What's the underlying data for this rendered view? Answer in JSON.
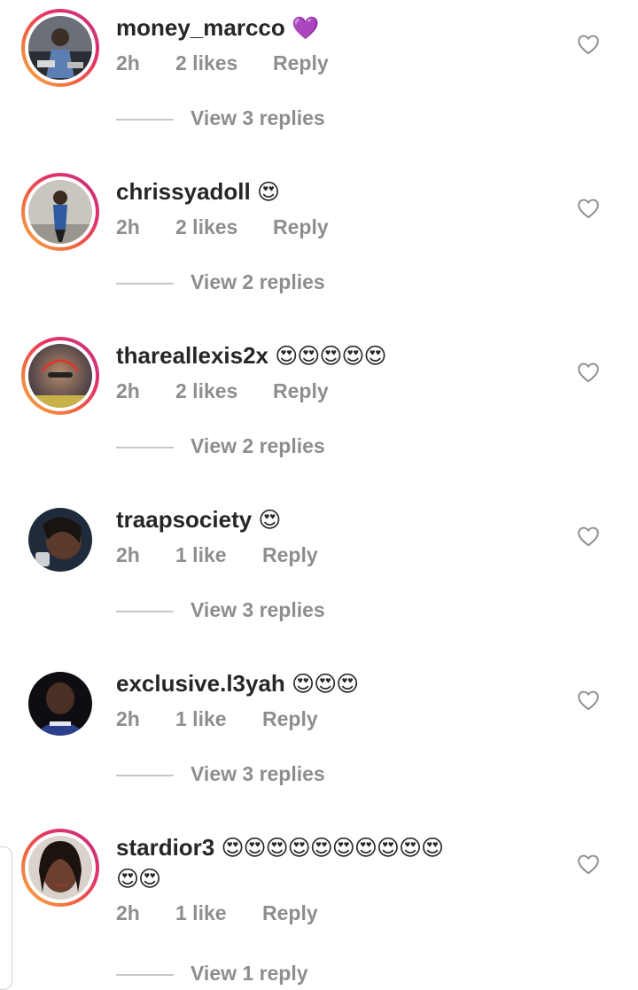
{
  "comments": [
    {
      "username": "money_marcco",
      "emoji": "💜",
      "time": "2h",
      "likes": "2 likes",
      "reply": "Reply",
      "view_replies": "View 3 replies"
    },
    {
      "username": "chrissyadoll",
      "emoji": "😍",
      "time": "2h",
      "likes": "2 likes",
      "reply": "Reply",
      "view_replies": "View 2 replies"
    },
    {
      "username": "thareallexis2x",
      "emoji": "😍😍😍😍😍",
      "time": "2h",
      "likes": "2 likes",
      "reply": "Reply",
      "view_replies": "View 2 replies"
    },
    {
      "username": "traapsociety",
      "emoji": "😍",
      "time": "2h",
      "likes": "1 like",
      "reply": "Reply",
      "view_replies": "View 3 replies"
    },
    {
      "username": "exclusive.l3yah",
      "emoji": "😍😍😍",
      "time": "2h",
      "likes": "1 like",
      "reply": "Reply",
      "view_replies": "View 3 replies"
    },
    {
      "username": "stardior3",
      "emoji": "😍😍😍😍😍😍😍😍😍😍",
      "emoji_line2": "😍😍",
      "time": "2h",
      "likes": "1 like",
      "reply": "Reply",
      "view_replies": "View 1 reply"
    }
  ],
  "icons": {
    "like": "heart-outline-icon"
  },
  "colors": {
    "text": "#262626",
    "secondary": "#8e8e8e",
    "story_ring_start": "#f9b24a",
    "story_ring_end": "#c13584"
  }
}
